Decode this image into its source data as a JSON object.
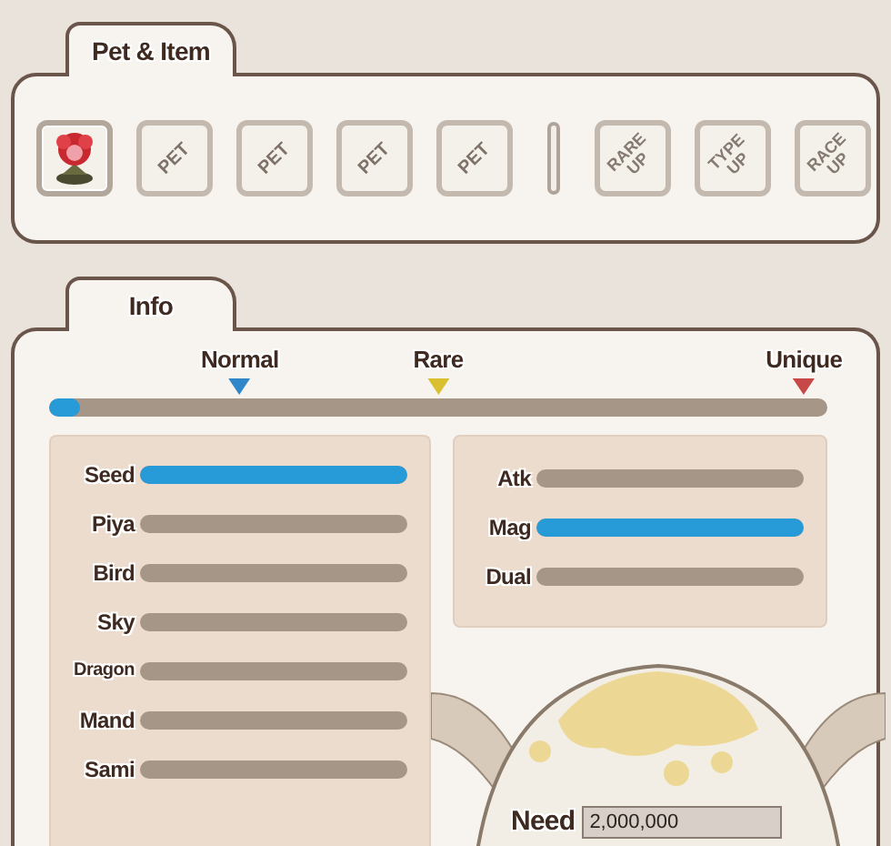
{
  "pet_item": {
    "tab": "Pet & Item",
    "slots": [
      {
        "kind": "pet"
      },
      {
        "kind": "empty",
        "label": "PET"
      },
      {
        "kind": "empty",
        "label": "PET"
      },
      {
        "kind": "empty",
        "label": "PET"
      },
      {
        "kind": "empty",
        "label": "PET"
      },
      {
        "kind": "divider"
      },
      {
        "kind": "upgrade",
        "label": "RARE UP"
      },
      {
        "kind": "upgrade",
        "label": "TYPE UP"
      },
      {
        "kind": "upgrade",
        "label": "RACE UP"
      }
    ]
  },
  "info": {
    "tab": "Info",
    "grades": [
      {
        "name": "Normal",
        "color": "#2f86c8"
      },
      {
        "name": "Rare",
        "color": "#d8c030"
      },
      {
        "name": "Unique",
        "color": "#c84848"
      }
    ],
    "grade_progress": {
      "level": 0.04
    },
    "races": [
      {
        "label": "Seed",
        "level": 1
      },
      {
        "label": "Piya",
        "level": 0
      },
      {
        "label": "Bird",
        "level": 0
      },
      {
        "label": "Sky",
        "level": 0
      },
      {
        "label": "Dragon",
        "level": 0
      },
      {
        "label": "Mand",
        "level": 0
      },
      {
        "label": "Sami",
        "level": 0
      }
    ],
    "types": [
      {
        "label": "Atk",
        "level": 0
      },
      {
        "label": "Mag",
        "level": 1
      },
      {
        "label": "Dual",
        "level": 0
      }
    ],
    "need": {
      "label": "Need",
      "value": "2,000,000"
    }
  }
}
